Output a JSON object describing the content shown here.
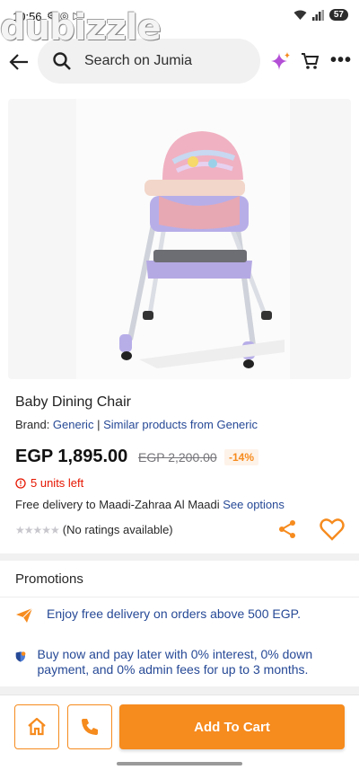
{
  "status_bar": {
    "time": "10:56",
    "battery": "57"
  },
  "watermark": "dubizzle",
  "header": {
    "search_placeholder": "Search on Jumia"
  },
  "product": {
    "title": "Baby Dining Chair",
    "brand_prefix": "Brand: ",
    "brand_name": "Generic",
    "brand_separator": " | ",
    "similar_link": "Similar products from Generic",
    "price": "EGP 1,895.00",
    "old_price": "EGP 2,200.00",
    "discount": "-14%",
    "stock": "5 units left",
    "delivery_text": "Free delivery to Maadi-Zahraa Al Maadi ",
    "delivery_link": "See options",
    "rating_text": "(No ratings available)"
  },
  "promotions": {
    "title": "Promotions",
    "items": [
      {
        "text": "Enjoy free delivery on orders above 500 EGP.",
        "icon": "megaphone-icon"
      },
      {
        "text": "Buy now and pay later with 0% interest, 0% down payment, and 0% admin fees for up to 3 months.",
        "icon": "shield-icon"
      }
    ]
  },
  "bottom_bar": {
    "add_to_cart": "Add To Cart"
  },
  "colors": {
    "accent": "#f68b1e",
    "link": "#264996",
    "stock": "#e61601"
  }
}
